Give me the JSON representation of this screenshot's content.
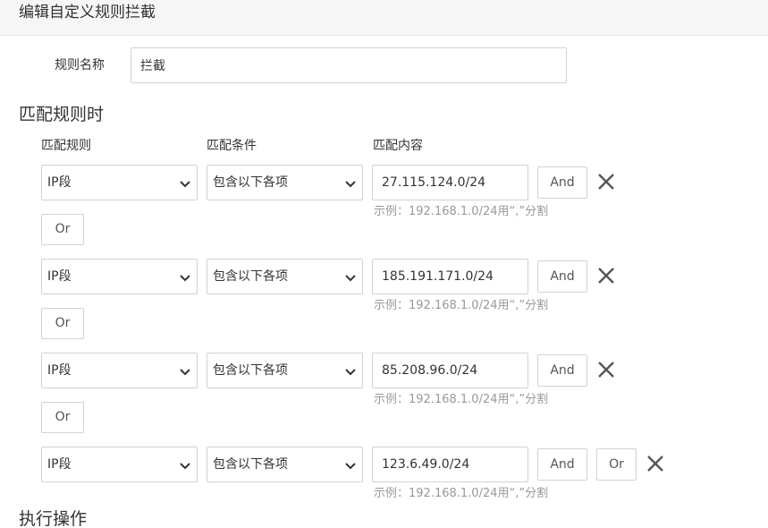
{
  "header": {
    "title": "编辑自定义规则拦截"
  },
  "rule_name": {
    "label": "规则名称",
    "value": "拦截"
  },
  "match_section": {
    "title": "匹配规则时",
    "columns": {
      "rule": "匹配规则",
      "condition": "匹配条件",
      "content": "匹配内容"
    },
    "hint": "示例：192.168.1.0/24用“,”分割",
    "and_label": "And",
    "or_label": "Or",
    "rows": [
      {
        "type": "IP段",
        "condition": "包含以下各项",
        "value": "27.115.124.0/24"
      },
      {
        "type": "IP段",
        "condition": "包含以下各项",
        "value": "185.191.171.0/24"
      },
      {
        "type": "IP段",
        "condition": "包含以下各项",
        "value": "85.208.96.0/24"
      },
      {
        "type": "IP段",
        "condition": "包含以下各项",
        "value": "123.6.49.0/24"
      }
    ]
  },
  "action_section": {
    "title": "执行操作"
  },
  "icons": {
    "dropdown": "chevron-down-icon",
    "remove": "close-icon"
  }
}
